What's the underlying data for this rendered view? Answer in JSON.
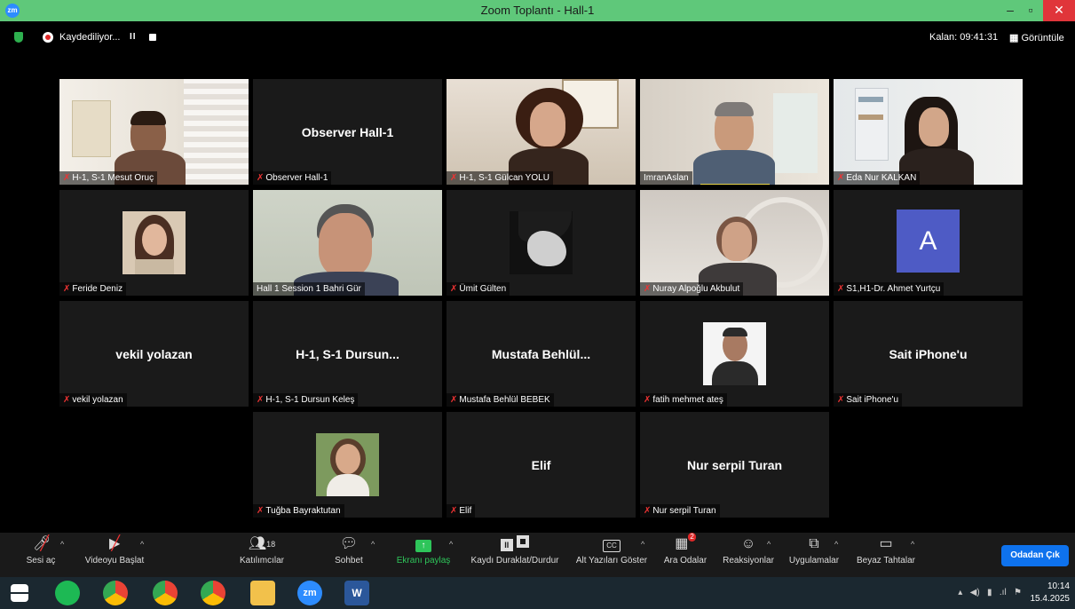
{
  "window": {
    "title": "Zoom Toplantı - Hall-1",
    "app_icon": "zm"
  },
  "recording": {
    "label": "Kaydediliyor...",
    "pause": "II",
    "remaining": "Kalan: 09:41:31",
    "view": "Görüntüle"
  },
  "tiles": [
    {
      "name": "H-1, S-1 Mesut Oruç",
      "center": ""
    },
    {
      "name": "Observer Hall-1",
      "center": "Observer Hall-1"
    },
    {
      "name": "H-1, S-1 Gülcan YOLU",
      "center": ""
    },
    {
      "name": "ImranAslan",
      "center": ""
    },
    {
      "name": "Eda Nur KALKAN",
      "center": ""
    },
    {
      "name": "Feride Deniz",
      "center": ""
    },
    {
      "name": "Hall 1 Session 1 Bahri Gür",
      "center": ""
    },
    {
      "name": "Ümit Gülten",
      "center": ""
    },
    {
      "name": "Nuray Alpoğlu Akbulut",
      "center": ""
    },
    {
      "name": "S1,H1-Dr. Ahmet Yurtçu",
      "center": "",
      "avatar": "A"
    },
    {
      "name": "vekil yolazan",
      "center": "vekil yolazan"
    },
    {
      "name": "H-1, S-1 Dursun Keleş",
      "center": "H-1, S-1 Dursun..."
    },
    {
      "name": "Mustafa Behlül BEBEK",
      "center": "Mustafa  Behlül..."
    },
    {
      "name": "fatih mehmet ateş",
      "center": ""
    },
    {
      "name": "Sait iPhone'u",
      "center": "Sait iPhone'u"
    },
    {
      "name": "Tuğba Bayraktutan",
      "center": ""
    },
    {
      "name": "Elif",
      "center": "Elif"
    },
    {
      "name": "Nur serpil Turan",
      "center": "Nur serpil Turan"
    }
  ],
  "toolbar": {
    "audio": "Sesi aç",
    "video": "Videoyu Başlat",
    "participants": "Katılımcılar",
    "participants_count": "18",
    "chat": "Sohbet",
    "share": "Ekranı paylaş",
    "record": "Kaydı Duraklat/Durdur",
    "captions": "Alt Yazıları Göster",
    "captions_icon": "CC",
    "breakout": "Ara Odalar",
    "breakout_badge": "2",
    "reactions": "Reaksiyonlar",
    "apps": "Uygulamalar",
    "whiteboard": "Beyaz Tahtalar",
    "leave": "Odadan Çık"
  },
  "taskbar": {
    "time": "10:14",
    "date": "15.4.2025",
    "zoom_label": "zm",
    "word_label": "W"
  },
  "colors": {
    "accent": "#0e72ed",
    "share_green": "#2ec55a",
    "titlebar": "#5fc87a",
    "active_speaker": "#d4e157"
  }
}
